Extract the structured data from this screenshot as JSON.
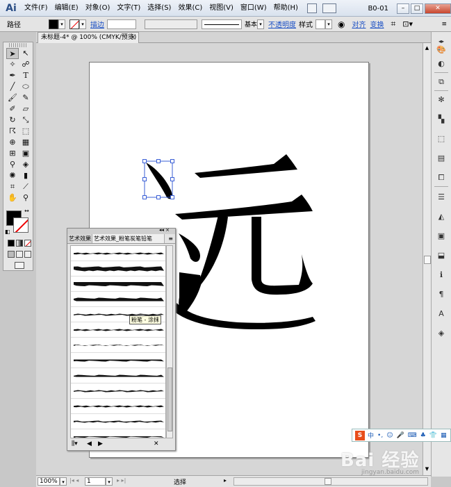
{
  "app": {
    "logo": "Ai"
  },
  "menu": [
    "文件(F)",
    "编辑(E)",
    "对象(O)",
    "文字(T)",
    "选择(S)",
    "效果(C)",
    "视图(V)",
    "窗口(W)",
    "帮助(H)"
  ],
  "workspace": "B0-01",
  "window_controls": {
    "minimize": "–",
    "maximize": "□",
    "close": "✕"
  },
  "control_bar": {
    "object_type": "路径",
    "stroke_label": "描边",
    "stroke_style": "基本",
    "opacity_link": "不透明度",
    "style_label": "样式",
    "align_link": "对齐",
    "transform_link": "变换"
  },
  "document_tab": {
    "title": "未标题-4* @ 100% (CMYK/预览)",
    "close": "×"
  },
  "canvas": {
    "glyph": "远"
  },
  "brush_panel": {
    "tabs": [
      "艺术效果",
      "艺术效果_粉笔炭笔铅笔"
    ],
    "tooltip": "粉笔 - 涂抹",
    "brush_count": 13
  },
  "status_bar": {
    "zoom": "100%",
    "page": "1",
    "tool_status": "选择"
  },
  "ime_bar": {
    "logo": "S",
    "mode": "中"
  },
  "watermark": {
    "brand": "Bai 经验",
    "url": "jingyan.baidu.com"
  },
  "colors": {
    "selection": "#3a5fd6",
    "accent": "#1a4fc4",
    "ime": "#e84e1c"
  }
}
